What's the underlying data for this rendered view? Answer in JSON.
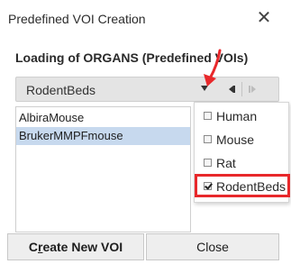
{
  "window": {
    "title": "Predefined VOI Creation"
  },
  "section": {
    "title": "Loading of ORGANS (Predefined VOIs)"
  },
  "combo": {
    "selected_value": "RodentBeds"
  },
  "list": {
    "items": [
      "AlbiraMouse",
      "BrukerMMPFmouse"
    ],
    "selected_index": 1
  },
  "dropdown": {
    "items": [
      {
        "label": "Human",
        "checked": false
      },
      {
        "label": "Mouse",
        "checked": false
      },
      {
        "label": "Rat",
        "checked": false
      },
      {
        "label": "RodentBeds",
        "checked": true
      }
    ]
  },
  "buttons": {
    "create_first": "C",
    "create_mnemonic": "r",
    "create_rest": "eate New VOI",
    "close_label": "Close"
  },
  "colors": {
    "highlight": "#e8282b",
    "selection": "#c7d9ee"
  }
}
